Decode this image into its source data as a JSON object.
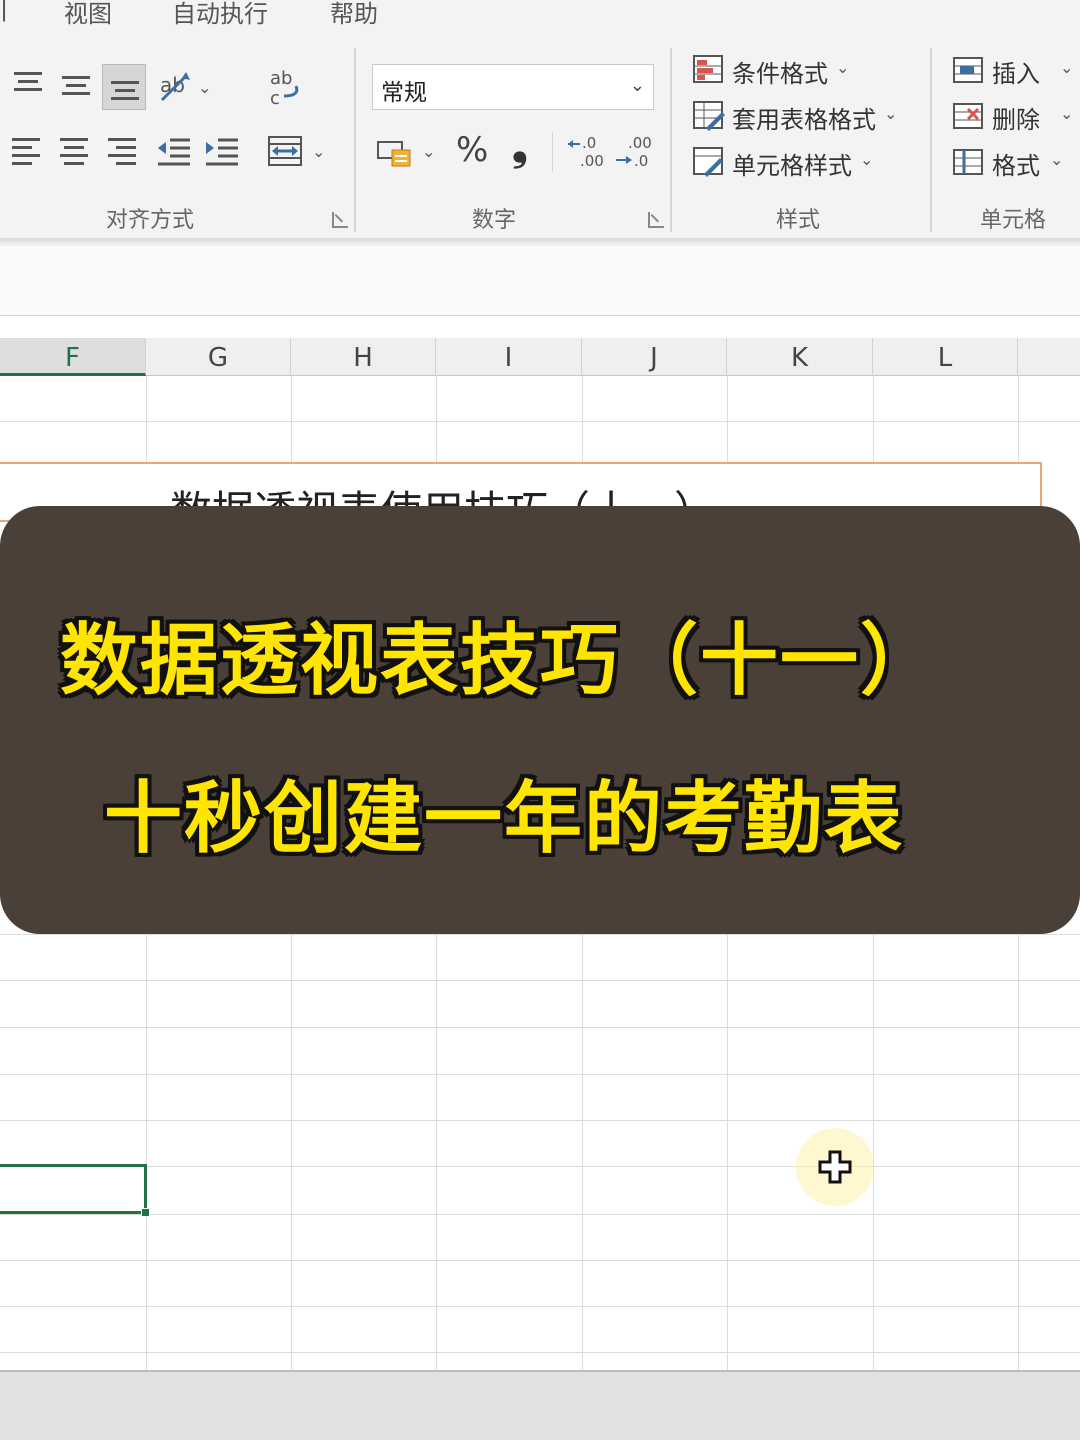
{
  "menu_tabs": [
    "视图",
    "自动执行",
    "帮助"
  ],
  "ribbon": {
    "alignment": {
      "label": "对齐方式"
    },
    "number": {
      "label": "数字",
      "format_value": "常规",
      "percent": "%",
      "comma": "❟"
    },
    "styles": {
      "label": "样式",
      "conditional_formatting": "条件格式",
      "format_as_table": "套用表格格式",
      "cell_styles": "单元格样式"
    },
    "cells": {
      "label": "单元格",
      "insert": "插入",
      "delete": "删除",
      "format": "格式"
    }
  },
  "columns": [
    "F",
    "G",
    "H",
    "I",
    "J",
    "K",
    "L"
  ],
  "sheet": {
    "title_cell_text": "数据透视表使用技巧（十一）"
  },
  "overlay": {
    "line1": "数据透视表技巧（十一）",
    "line2": "十秒创建一年的考勤表"
  },
  "colors": {
    "excel_green": "#217346",
    "overlay_bg": "#4a4038",
    "overlay_text": "#ffe500"
  }
}
